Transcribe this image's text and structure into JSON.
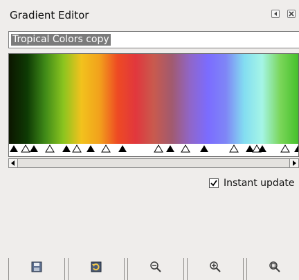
{
  "window": {
    "title": "Gradient Editor",
    "menu_icon": "tab-menu-icon",
    "close_icon": "close-icon"
  },
  "gradient": {
    "name": "Tropical Colors copy",
    "preview_colors": [
      "#0c1600",
      "#0e3a04",
      "#3f8a18",
      "#8bc41f",
      "#f2c21d",
      "#f2a11c",
      "#ee4a23",
      "#e1373d",
      "#c95a4e",
      "#a15a6f",
      "#9066c8",
      "#7b6cff",
      "#7f86f6",
      "#83ddf1",
      "#a5f5e6",
      "#7ad659",
      "#46c02c"
    ]
  },
  "stops_colors": {
    "filled": "#000000",
    "hollow": "#ffffff"
  },
  "instant_update": {
    "label": "Instant update",
    "checked": true
  },
  "toolbar": {
    "buttons": [
      {
        "name": "save-gradient-button",
        "icon": "save-icon"
      },
      {
        "name": "revert-button",
        "icon": "revert-icon"
      },
      {
        "name": "zoom-out-button",
        "icon": "zoom-out-icon"
      },
      {
        "name": "zoom-in-button",
        "icon": "zoom-in-icon"
      },
      {
        "name": "zoom-all-button",
        "icon": "zoom-all-icon"
      }
    ]
  }
}
